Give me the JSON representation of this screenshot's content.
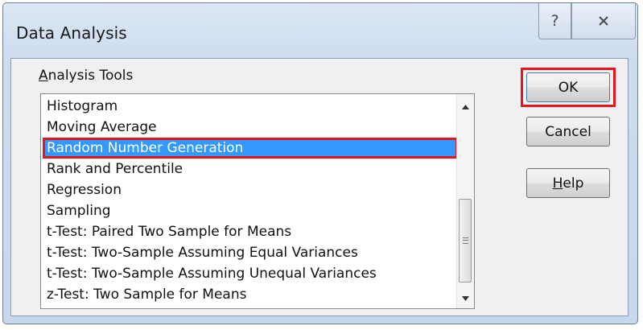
{
  "window": {
    "title": "Data Analysis",
    "help_glyph": "?"
  },
  "group_label_accel": "A",
  "group_label_rest": "nalysis Tools",
  "list": {
    "items": [
      {
        "label": "Histogram",
        "selected": false
      },
      {
        "label": "Moving Average",
        "selected": false
      },
      {
        "label": "Random Number Generation",
        "selected": true
      },
      {
        "label": "Rank and Percentile",
        "selected": false
      },
      {
        "label": "Regression",
        "selected": false
      },
      {
        "label": "Sampling",
        "selected": false
      },
      {
        "label": "t-Test: Paired Two Sample for Means",
        "selected": false
      },
      {
        "label": "t-Test: Two-Sample Assuming Equal Variances",
        "selected": false
      },
      {
        "label": "t-Test: Two-Sample Assuming Unequal Variances",
        "selected": false
      },
      {
        "label": "z-Test: Two Sample for Means",
        "selected": false
      }
    ]
  },
  "buttons": {
    "ok": "OK",
    "cancel": "Cancel",
    "help_accel": "H",
    "help_rest": "elp"
  },
  "colors": {
    "selection": "#3399ff",
    "highlight_outline": "#e8141d"
  },
  "icons": {
    "help": "question-mark-icon",
    "close": "close-x-icon",
    "scroll_up": "triangle-up-icon",
    "scroll_down": "triangle-down-icon"
  }
}
